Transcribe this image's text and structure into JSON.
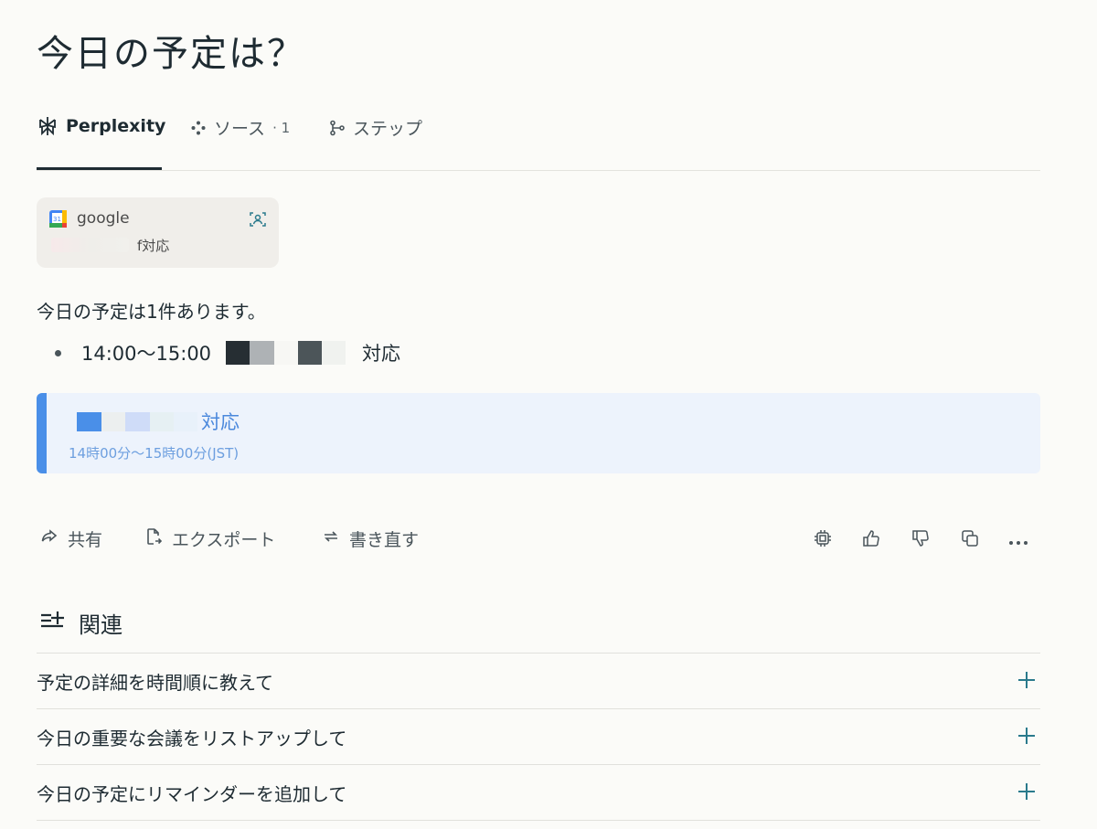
{
  "title": "今日の予定は？",
  "tabs": [
    {
      "label": "Perplexity",
      "icon": "perplexity-logo-icon"
    },
    {
      "label": "ソース",
      "count": "· 1",
      "icon": "sources-icon"
    },
    {
      "label": "ステップ",
      "icon": "steps-icon"
    }
  ],
  "source": {
    "name": "google",
    "snippet": "f対応",
    "icon": "google-calendar-icon"
  },
  "answer": {
    "intro": "今日の予定は1件あります。",
    "bullet_time": "14:00〜15:00",
    "bullet_suffix": "対応"
  },
  "event": {
    "title": "対応",
    "time": "14時00分〜15時00分(JST)"
  },
  "actions": {
    "share": "共有",
    "export": "エクスポート",
    "rewrite": "書き直す"
  },
  "related": {
    "heading": "関連",
    "items": [
      "予定の詳細を時間順に教えて",
      "今日の重要な会議をリストアップして",
      "今日の予定にリマインダーを追加して"
    ]
  },
  "colors": {
    "accent": "#4a8fe8",
    "background": "#fbfbf8",
    "text": "#1e2b32",
    "plus": "#2a7a8c"
  }
}
